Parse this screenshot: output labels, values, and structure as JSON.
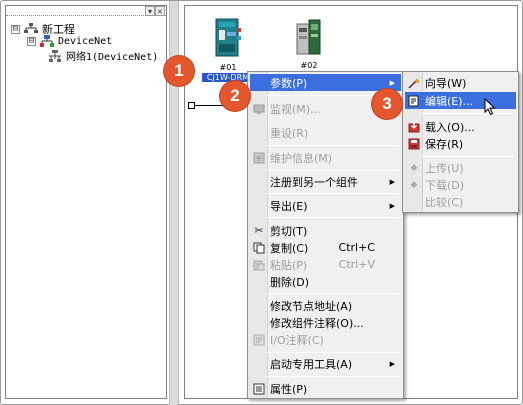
{
  "tree": {
    "root_label": "新工程",
    "network_label": "DeviceNet",
    "child_label": "网络1(DeviceNet)",
    "expander_minus": "⊟"
  },
  "devices": [
    {
      "address": "#01",
      "name": "CJ1W-DRM"
    },
    {
      "address": "#02",
      "name": ""
    }
  ],
  "badges": [
    "1",
    "2",
    "3"
  ],
  "context_menu": {
    "items": [
      {
        "label": "参数(P)",
        "has_submenu": true,
        "disabled": false,
        "icon": ""
      },
      {
        "label": "监视(M)...",
        "disabled": true,
        "icon": "monitor-icon"
      },
      {
        "label": "重设(R)",
        "disabled": true,
        "icon": ""
      },
      {
        "label": "维护信息(M)",
        "disabled": true,
        "icon": "maintenance-icon"
      },
      {
        "label": "注册到另一个组件",
        "has_submenu": true,
        "disabled": false,
        "icon": ""
      },
      {
        "label": "导出(E)",
        "has_submenu": true,
        "disabled": false,
        "icon": ""
      },
      {
        "label": "剪切(T)",
        "disabled": false,
        "icon": "scissors-icon"
      },
      {
        "label": "复制(C)",
        "shortcut": "Ctrl+C",
        "disabled": false,
        "icon": "copy-icon"
      },
      {
        "label": "粘贴(P)",
        "shortcut": "Ctrl+V",
        "disabled": true,
        "icon": "paste-icon"
      },
      {
        "label": "删除(D)",
        "disabled": false,
        "icon": ""
      },
      {
        "label": "修改节点地址(A)",
        "disabled": false,
        "icon": ""
      },
      {
        "label": "修改组件注释(O)...",
        "disabled": false,
        "icon": ""
      },
      {
        "label": "I/O注释(C)",
        "disabled": true,
        "icon": "io-comment-icon"
      },
      {
        "label": "启动专用工具(A)",
        "has_submenu": true,
        "disabled": false,
        "icon": ""
      },
      {
        "label": "属性(P)",
        "disabled": false,
        "icon": "properties-icon"
      }
    ]
  },
  "submenu": {
    "items": [
      {
        "label": "向导(W)",
        "disabled": false,
        "icon": "wizard-icon"
      },
      {
        "label": "编辑(E)...",
        "disabled": false,
        "highlighted": true,
        "icon": "edit-icon"
      },
      {
        "label": "载入(O)...",
        "disabled": false,
        "icon": "load-icon"
      },
      {
        "label": "保存(R)",
        "disabled": false,
        "icon": "save-icon"
      },
      {
        "label": "上传(U)",
        "disabled": true,
        "icon": "upload-icon"
      },
      {
        "label": "下载(D)",
        "disabled": true,
        "icon": "download-icon"
      },
      {
        "label": "比较(C)",
        "disabled": true,
        "icon": ""
      }
    ]
  },
  "colors": {
    "badge": "#e4572e",
    "highlight": "#3d6ee0",
    "device_teal": "#1f7f8a"
  }
}
